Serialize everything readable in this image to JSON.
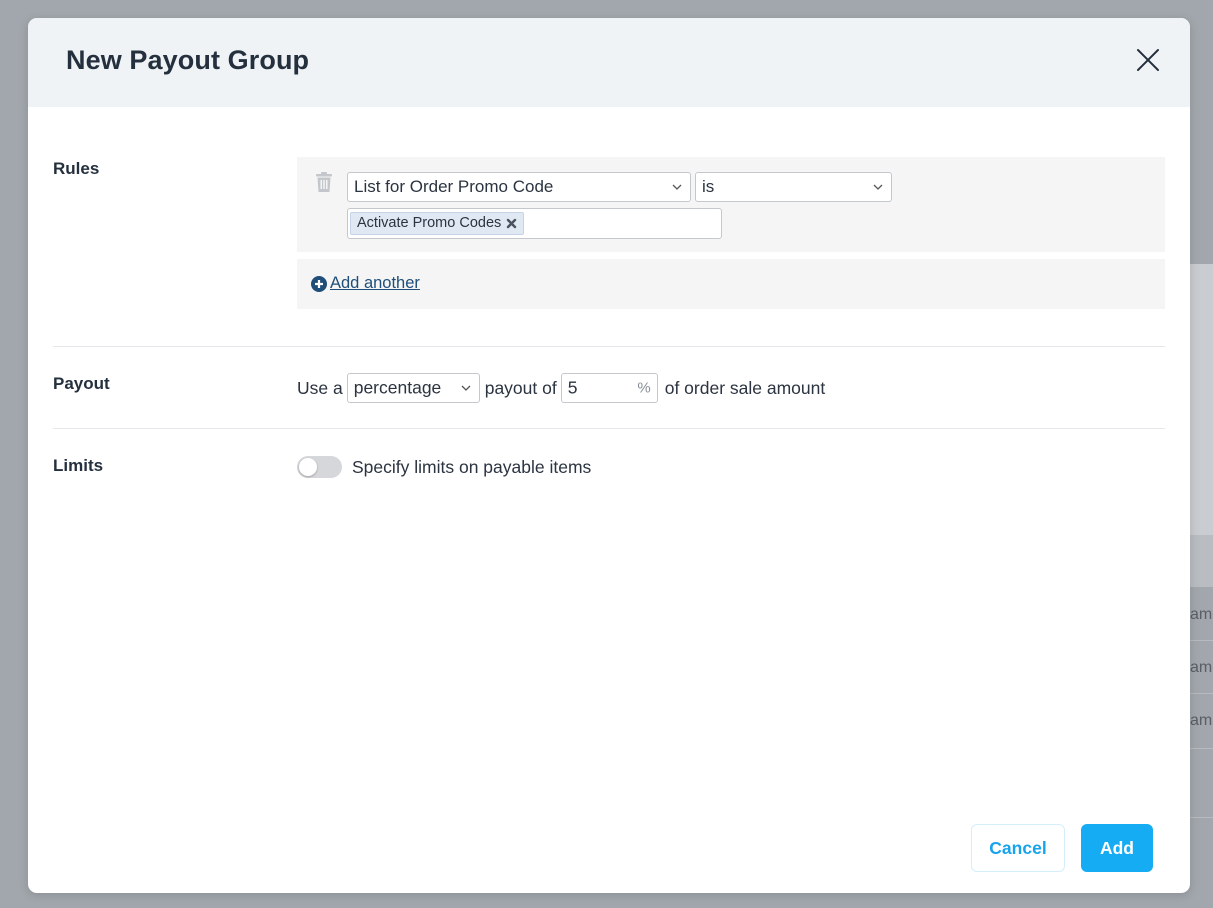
{
  "modal": {
    "title": "New Payout Group",
    "close_icon": "close-icon"
  },
  "rules": {
    "label": "Rules",
    "rule": {
      "field": "List for Order Promo Code",
      "operator": "is",
      "tags": [
        "Activate Promo Codes"
      ]
    },
    "add_another": "Add another"
  },
  "payout": {
    "label": "Payout",
    "prefix": "Use a",
    "type": "percentage",
    "middle": "payout of",
    "amount": "5",
    "unit": "%",
    "suffix": "of order sale amount"
  },
  "limits": {
    "label": "Limits",
    "toggle_label": "Specify limits on payable items",
    "enabled": false
  },
  "footer": {
    "cancel": "Cancel",
    "add": "Add"
  },
  "background": {
    "cells": [
      "amo",
      "amo",
      "am"
    ]
  },
  "colors": {
    "primary": "#15acf4",
    "link": "#1f4e79",
    "heading": "#25303e"
  }
}
